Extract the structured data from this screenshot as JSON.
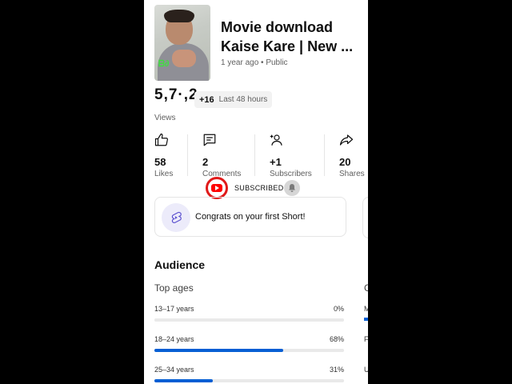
{
  "video": {
    "title_line1": "Movie download",
    "title_line2": "Kaise Kare | New ...",
    "meta": "1 year ago • Public"
  },
  "views": {
    "count": "5,7·,2",
    "delta": "+16",
    "period": "Last 48 hours",
    "label": "Views"
  },
  "stats": [
    {
      "icon": "thumbs-up-icon",
      "value": "58",
      "label": "Likes"
    },
    {
      "icon": "comment-icon",
      "value": "2",
      "label": "Comments"
    },
    {
      "icon": "add-person-icon",
      "value": "+1",
      "label": "Subscribers"
    },
    {
      "icon": "share-icon",
      "value": "20",
      "label": "Shares"
    }
  ],
  "subscribe": {
    "label": "SUBSCRIBED",
    "icon": "youtube-logo-icon",
    "bell_icon": "bell-icon"
  },
  "card": {
    "text": "Congrats on your first Short!",
    "icon": "shorts-icon"
  },
  "audience": {
    "title": "Audience",
    "top_ages_title": "Top ages",
    "gender_peek": "G",
    "ages": [
      {
        "label": "13–17 years",
        "pct": "0%",
        "value": 0
      },
      {
        "label": "18–24 years",
        "pct": "68%",
        "value": 68
      },
      {
        "label": "25–34 years",
        "pct": "31%",
        "value": 31
      }
    ],
    "peek_letters": [
      "M",
      "F",
      "U"
    ]
  },
  "colors": {
    "accent": "#065fd4",
    "youtube_red": "#ff0000",
    "background": "#ffffff"
  }
}
